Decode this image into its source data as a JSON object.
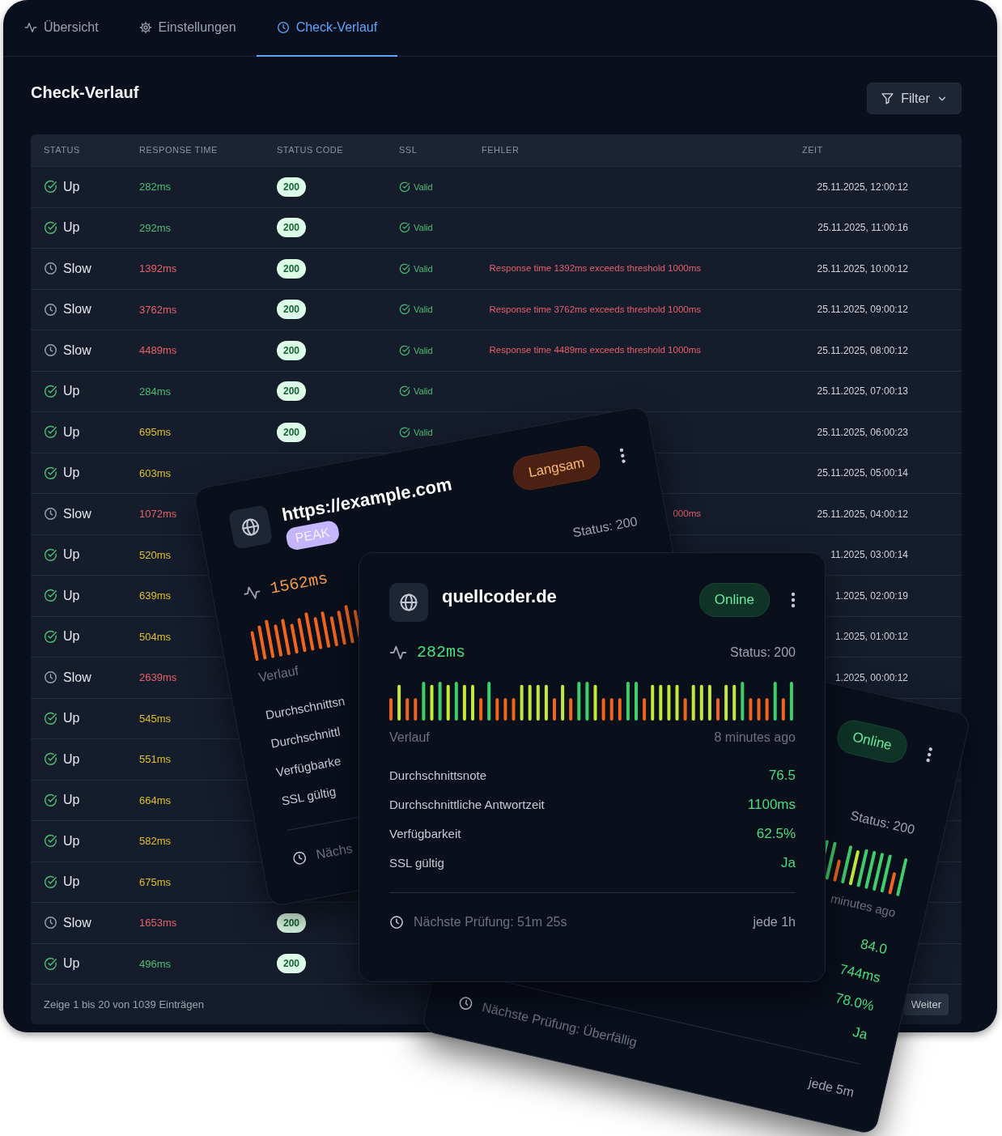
{
  "tabs": [
    {
      "label": "Übersicht",
      "kind": "pulse",
      "selected": false
    },
    {
      "label": "Einstellungen",
      "kind": "gear",
      "selected": false
    },
    {
      "label": "Check-Verlauf",
      "kind": "clock",
      "selected": true
    }
  ],
  "heading": "Check-Verlauf",
  "filter_button": "Filter",
  "table": {
    "columns": [
      "STATUS",
      "RESPONSE TIME",
      "STATUS CODE",
      "SSL",
      "FEHLER",
      "ZEIT"
    ],
    "rows": [
      {
        "status": "Up",
        "kind": "up",
        "response_time": "282ms",
        "color": "#4fbf73",
        "status_code": "200",
        "ssl": "Valid",
        "time": "25.11.2025, 12:00:12"
      },
      {
        "status": "Up",
        "kind": "up",
        "response_time": "292ms",
        "color": "#4fbf73",
        "status_code": "200",
        "ssl": "Valid",
        "time": "25.11.2025, 11:00:16"
      },
      {
        "status": "Slow",
        "kind": "slow",
        "response_time": "1392ms",
        "color": "#e8606a",
        "status_code": "200",
        "ssl": "Valid",
        "error": "Response time 1392ms exceeds threshold 1000ms",
        "time": "25.11.2025, 10:00:12"
      },
      {
        "status": "Slow",
        "kind": "slow",
        "response_time": "3762ms",
        "color": "#e8606a",
        "status_code": "200",
        "ssl": "Valid",
        "error": "Response time 3762ms exceeds threshold 1000ms",
        "time": "25.11.2025, 09:00:12"
      },
      {
        "status": "Slow",
        "kind": "slow",
        "response_time": "4489ms",
        "color": "#e8606a",
        "status_code": "200",
        "ssl": "Valid",
        "error": "Response time 4489ms exceeds threshold 1000ms",
        "time": "25.11.2025, 08:00:12"
      },
      {
        "status": "Up",
        "kind": "up",
        "response_time": "284ms",
        "color": "#4fbf73",
        "status_code": "200",
        "ssl": "Valid",
        "time": "25.11.2025, 07:00:13"
      },
      {
        "status": "Up",
        "kind": "up",
        "response_time": "695ms",
        "color": "#e0c02a",
        "status_code": "200",
        "ssl": "Valid",
        "time": "25.11.2025, 06:00:23"
      },
      {
        "status": "Up",
        "kind": "up",
        "response_time": "603ms",
        "color": "#e0c02a",
        "time": "25.11.2025, 05:00:14"
      },
      {
        "status": "Slow",
        "kind": "slow",
        "response_time": "1072ms",
        "color": "#e8606a",
        "error": "000ms",
        "time": "25.11.2025, 04:00:12"
      },
      {
        "status": "Up",
        "kind": "up",
        "response_time": "520ms",
        "color": "#e0c02a",
        "time": "11.2025, 03:00:14"
      },
      {
        "status": "Up",
        "kind": "up",
        "response_time": "639ms",
        "color": "#e0c02a",
        "time": "1.2025, 02:00:19"
      },
      {
        "status": "Up",
        "kind": "up",
        "response_time": "504ms",
        "color": "#e0c02a",
        "time": "1.2025, 01:00:12"
      },
      {
        "status": "Slow",
        "kind": "slow",
        "response_time": "2639ms",
        "color": "#e8606a",
        "time": "1.2025, 00:00:12"
      },
      {
        "status": "Up",
        "kind": "up",
        "response_time": "545ms",
        "color": "#e0c02a"
      },
      {
        "status": "Up",
        "kind": "up",
        "response_time": "551ms",
        "color": "#e0c02a"
      },
      {
        "status": "Up",
        "kind": "up",
        "response_time": "664ms",
        "color": "#e0c02a"
      },
      {
        "status": "Up",
        "kind": "up",
        "response_time": "582ms",
        "color": "#e0c02a"
      },
      {
        "status": "Up",
        "kind": "up",
        "response_time": "675ms",
        "color": "#e0c02a"
      },
      {
        "status": "Slow",
        "kind": "slow",
        "response_time": "1653ms",
        "color": "#e8606a",
        "status_code": "200"
      },
      {
        "status": "Up",
        "kind": "up",
        "response_time": "496ms",
        "color": "#4fbf73",
        "status_code": "200"
      }
    ]
  },
  "footer": {
    "summary": "Zeige 1 bis 20 von 1039 Einträgen",
    "next_button": "Weiter"
  },
  "cards": [
    {
      "kind": "tilted-left",
      "globe": true,
      "title": "https://example.com",
      "tag": "PEAK",
      "badge": {
        "text": "Langsam",
        "kind": "slow"
      },
      "response": {
        "text": "1562ms",
        "color": "#f39a4a"
      },
      "status": "Status: 200",
      "history_label": "Verlauf",
      "stats": [
        {
          "label": "Durchschnittsn"
        },
        {
          "label": "Durchschnittl"
        },
        {
          "label": "Verfügbarke"
        },
        {
          "label": "SSL gültig"
        }
      ],
      "next_check": "Nächs"
    },
    {
      "kind": "tilted-right",
      "badge": {
        "text": "Online",
        "kind": "online"
      },
      "status": "Status: 200",
      "history_time": "minutes ago",
      "stats": [
        {
          "value": "84.0"
        },
        {
          "value": "744ms"
        },
        {
          "value": "78.0%"
        },
        {
          "value": "Ja"
        }
      ],
      "next_check": "Nächste Prüfung: Überfällig",
      "interval": "jede 5m"
    },
    {
      "kind": "front",
      "globe": true,
      "title": "quellcoder.de",
      "badge": {
        "text": "Online",
        "kind": "online"
      },
      "response": {
        "text": "282ms",
        "color": "#4ade80"
      },
      "status": "Status: 200",
      "history_label": "Verlauf",
      "history_time": "8 minutes ago",
      "stats": [
        {
          "label": "Durchschnittsnote",
          "value": "76.5"
        },
        {
          "label": "Durchschnittliche Antwortzeit",
          "value": "1100ms"
        },
        {
          "label": "Verfügbarkeit",
          "value": "62.5%"
        },
        {
          "label": "SSL gültig",
          "value": "Ja"
        }
      ],
      "next_check": "Nächste Prüfung: 51m 25s",
      "interval": "jede 1h"
    }
  ]
}
